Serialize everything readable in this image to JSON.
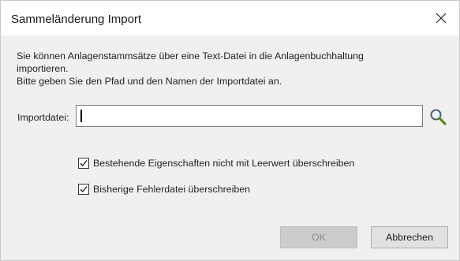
{
  "dialog": {
    "title": "Sammeländerung Import",
    "close_icon": "close-icon"
  },
  "description": {
    "line1": "Sie können Anlagenstammsätze über eine Text-Datei in die Anlagenbuchhaltung",
    "line2": "importieren.",
    "line3": "Bitte geben Sie den Pfad und den Namen der Importdatei an."
  },
  "import": {
    "label": "Importdatei:",
    "value": "",
    "search_icon": "magnifier-icon"
  },
  "options": [
    {
      "label": "Bestehende Eigenschaften nicht mit Leerwert überschreiben",
      "checked": true
    },
    {
      "label": "Bisherige Fehlerdatei überschreiben",
      "checked": true
    }
  ],
  "buttons": {
    "ok_label": "OK",
    "ok_enabled": false,
    "cancel_label": "Abbrechen"
  }
}
